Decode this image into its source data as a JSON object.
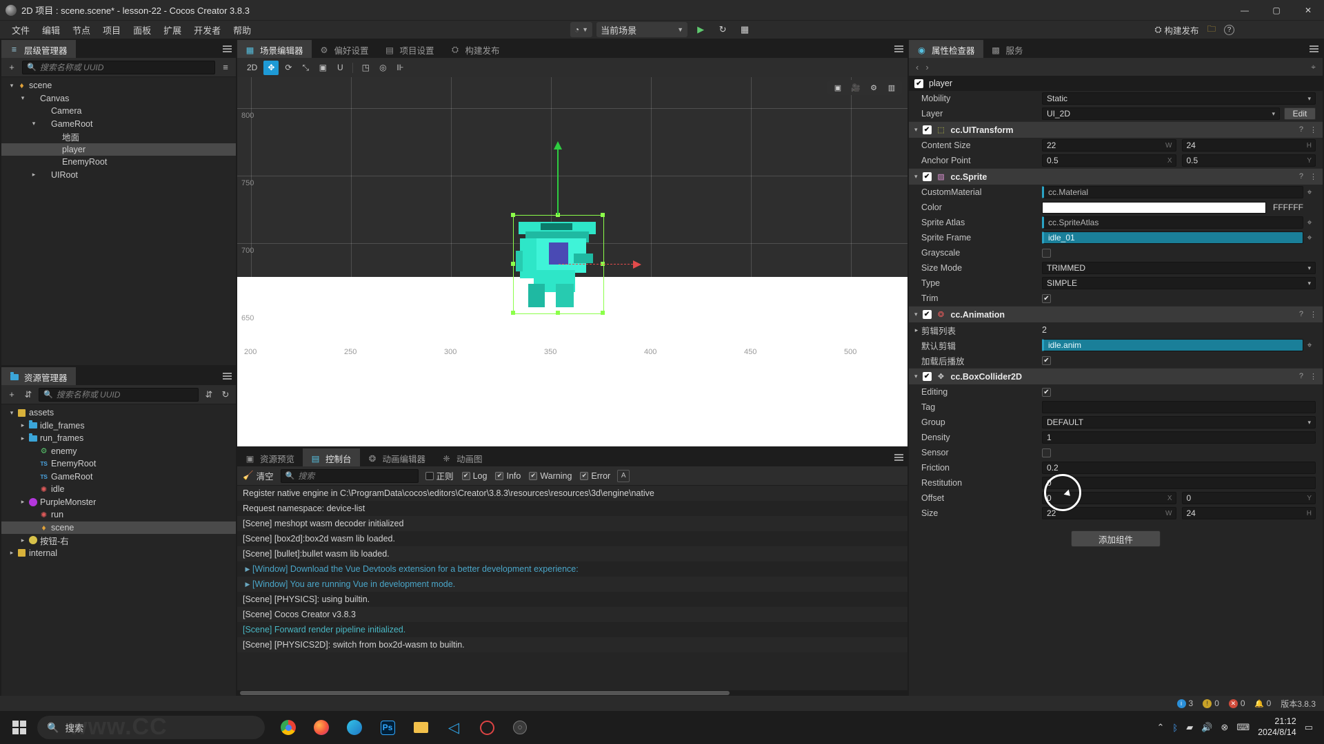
{
  "titlebar": {
    "title": "2D 项目 : scene.scene* - lesson-22 - Cocos Creator 3.8.3",
    "minimize": "—",
    "maximize": "▢",
    "close": "✕"
  },
  "menubar": {
    "items": [
      "文件",
      "编辑",
      "节点",
      "项目",
      "面板",
      "扩展",
      "开发者",
      "帮助"
    ],
    "scene_select": "当前场景",
    "play_icon": "▶",
    "refresh_icon": "↻",
    "device_icon": "▦",
    "build_label": "构建发布",
    "folder_icon": "📁",
    "help_icon": "?"
  },
  "hierarchy": {
    "tab_label": "层级管理器",
    "search_placeholder": "搜索名称或 UUID",
    "add_icon": "+",
    "filter_icon": "≡",
    "nodes": [
      {
        "label": "scene",
        "depth": 0,
        "icon": "scene-icon",
        "twisty": "▾",
        "selected": false
      },
      {
        "label": "Canvas",
        "depth": 1,
        "icon": "none",
        "twisty": "▾",
        "selected": false
      },
      {
        "label": "Camera",
        "depth": 2,
        "icon": "none",
        "twisty": "",
        "selected": false
      },
      {
        "label": "GameRoot",
        "depth": 2,
        "icon": "none",
        "twisty": "▾",
        "selected": false
      },
      {
        "label": "地面",
        "depth": 3,
        "icon": "none",
        "twisty": "",
        "selected": false
      },
      {
        "label": "player",
        "depth": 3,
        "icon": "none",
        "twisty": "",
        "selected": true
      },
      {
        "label": "EnemyRoot",
        "depth": 3,
        "icon": "none",
        "twisty": "",
        "selected": false
      },
      {
        "label": "UIRoot",
        "depth": 2,
        "icon": "none",
        "twisty": "▸",
        "selected": false
      }
    ]
  },
  "assets": {
    "tab_label": "资源管理器",
    "search_placeholder": "搜索名称或 UUID",
    "add_icon": "+",
    "sort_icon": "⇵",
    "refresh_icon": "↻",
    "nodes": [
      {
        "label": "assets",
        "depth": 0,
        "icon": "assets-icon",
        "twisty": "▾",
        "selected": false
      },
      {
        "label": "idle_frames",
        "depth": 1,
        "icon": "folder-icon",
        "twisty": "▸",
        "selected": false
      },
      {
        "label": "run_frames",
        "depth": 1,
        "icon": "folder-icon",
        "twisty": "▸",
        "selected": false
      },
      {
        "label": "enemy",
        "depth": 2,
        "icon": "prefab-icon",
        "twisty": "",
        "selected": false
      },
      {
        "label": "EnemyRoot",
        "depth": 2,
        "icon": "ts-icon",
        "twisty": "",
        "selected": false
      },
      {
        "label": "GameRoot",
        "depth": 2,
        "icon": "ts-icon",
        "twisty": "",
        "selected": false
      },
      {
        "label": "idle",
        "depth": 2,
        "icon": "anim-icon",
        "twisty": "",
        "selected": false
      },
      {
        "label": "PurpleMonster",
        "depth": 1,
        "icon": "monster-icon",
        "twisty": "▸",
        "selected": false
      },
      {
        "label": "run",
        "depth": 2,
        "icon": "anim-icon",
        "twisty": "",
        "selected": false
      },
      {
        "label": "scene",
        "depth": 2,
        "icon": "scene-icon",
        "twisty": "",
        "selected": true
      },
      {
        "label": "按钮-右",
        "depth": 1,
        "icon": "button-icon",
        "twisty": "▸",
        "selected": false
      },
      {
        "label": "internal",
        "depth": 0,
        "icon": "assets-icon",
        "twisty": "▸",
        "selected": false
      }
    ]
  },
  "sceneview": {
    "tabs": [
      {
        "label": "场景编辑器",
        "icon": "scene-editor-icon",
        "active": true
      },
      {
        "label": "偏好设置",
        "icon": "gear-icon",
        "active": false
      },
      {
        "label": "项目设置",
        "icon": "project-icon",
        "active": false
      },
      {
        "label": "构建发布",
        "icon": "build-icon",
        "active": false
      }
    ],
    "mode_label": "2D",
    "tools": [
      "move-tool",
      "rotate-tool",
      "scale-tool",
      "rect-tool",
      "unit-tool",
      "align-tool",
      "pivot-tool",
      "ruler-tool"
    ],
    "overlay_buttons": [
      "camera-preview-icon",
      "camera-icon",
      "gizmo-settings-icon",
      "effects-icon"
    ],
    "ruler_y": [
      "800",
      "750",
      "700",
      "650"
    ],
    "ruler_x": [
      "200",
      "250",
      "300",
      "350",
      "400",
      "450",
      "500"
    ]
  },
  "console": {
    "tabs": [
      {
        "label": "资源预览",
        "icon": "assets-preview-icon",
        "active": false
      },
      {
        "label": "控制台",
        "icon": "console-icon",
        "active": true
      },
      {
        "label": "动画编辑器",
        "icon": "anim-editor-icon",
        "active": false
      },
      {
        "label": "动画图",
        "icon": "anim-graph-icon",
        "active": false
      }
    ],
    "clear_label": "清空",
    "search_placeholder": "搜索",
    "filters": [
      {
        "label": "正则",
        "checked": false
      },
      {
        "label": "Log",
        "checked": true
      },
      {
        "label": "Info",
        "checked": true
      },
      {
        "label": "Warning",
        "checked": true
      },
      {
        "label": "Error",
        "checked": true
      }
    ],
    "font_icon": "A",
    "logs": [
      {
        "text": "Register native engine in C:\\ProgramData\\cocos\\editors\\Creator\\3.8.3\\resources\\resources\\3d\\engine\\native",
        "style": "info",
        "expandable": false
      },
      {
        "text": "Request namespace: device-list",
        "style": "info",
        "expandable": false
      },
      {
        "text": "[Scene] meshopt wasm decoder initialized",
        "style": "info",
        "expandable": false
      },
      {
        "text": "[Scene] [box2d]:box2d wasm lib loaded.",
        "style": "info",
        "expandable": false
      },
      {
        "text": "[Scene] [bullet]:bullet wasm lib loaded.",
        "style": "info",
        "expandable": false
      },
      {
        "text": "[Window] Download the Vue Devtools extension for a better development experience:",
        "style": "vue",
        "expandable": true
      },
      {
        "text": "[Window] You are running Vue in development mode.",
        "style": "vue",
        "expandable": true
      },
      {
        "text": "[Scene] [PHYSICS]: using builtin.",
        "style": "info",
        "expandable": false
      },
      {
        "text": "[Scene] Cocos Creator v3.8.3",
        "style": "info",
        "expandable": false
      },
      {
        "text": "[Scene] Forward render pipeline initialized.",
        "style": "ok",
        "expandable": false
      },
      {
        "text": "[Scene] [PHYSICS2D]: switch from box2d-wasm to builtin.",
        "style": "info",
        "expandable": false
      }
    ]
  },
  "inspector": {
    "tabs": [
      {
        "label": "属性检查器",
        "icon": "inspector-icon",
        "active": true
      },
      {
        "label": "服务",
        "icon": "services-icon",
        "active": false
      }
    ],
    "back_icon": "‹",
    "forward_icon": "›",
    "pin_icon": "⌖",
    "node_name": "player",
    "node_props": [
      {
        "label": "Mobility",
        "value": "Static",
        "type": "select"
      },
      {
        "label": "Layer",
        "value": "UI_2D",
        "type": "select-edit",
        "edit_label": "Edit"
      }
    ],
    "components": [
      {
        "name": "cc.UITransform",
        "icon": "uitransform-icon",
        "enabled": true,
        "rows": [
          {
            "label": "Content Size",
            "type": "vec2",
            "x": "22",
            "y": "24",
            "sx": "W",
            "sy": "H"
          },
          {
            "label": "Anchor Point",
            "type": "vec2",
            "x": "0.5",
            "y": "0.5",
            "sx": "X",
            "sy": "Y"
          }
        ]
      },
      {
        "name": "cc.Sprite",
        "icon": "sprite-icon",
        "enabled": true,
        "rows": [
          {
            "label": "CustomMaterial",
            "type": "asset",
            "value": "cc.Material"
          },
          {
            "label": "Color",
            "type": "color",
            "value": "FFFFFF",
            "swatch": "#ffffff"
          },
          {
            "label": "Sprite Atlas",
            "type": "asset",
            "value": "cc.SpriteAtlas"
          },
          {
            "label": "Sprite Frame",
            "type": "assetfill",
            "value": "idle_01"
          },
          {
            "label": "Grayscale",
            "type": "checkbox",
            "checked": false
          },
          {
            "label": "Size Mode",
            "type": "select",
            "value": "TRIMMED"
          },
          {
            "label": "Type",
            "type": "select",
            "value": "SIMPLE"
          },
          {
            "label": "Trim",
            "type": "checkbox",
            "checked": true
          }
        ]
      },
      {
        "name": "cc.Animation",
        "icon": "animation-icon",
        "enabled": true,
        "rows": [
          {
            "label": "剪辑列表",
            "type": "number-fold",
            "value": "2",
            "twisty": "▸"
          },
          {
            "label": "默认剪辑",
            "type": "assetfill",
            "value": "idle.anim"
          },
          {
            "label": "加载后播放",
            "type": "checkbox",
            "checked": true
          }
        ]
      },
      {
        "name": "cc.BoxCollider2D",
        "icon": "collider-icon",
        "enabled": true,
        "rows": [
          {
            "label": "Editing",
            "type": "checkbox",
            "checked": true
          },
          {
            "label": "Tag",
            "type": "text",
            "value": ""
          },
          {
            "label": "Group",
            "type": "select",
            "value": "DEFAULT"
          },
          {
            "label": "Density",
            "type": "text",
            "value": "1"
          },
          {
            "label": "Sensor",
            "type": "checkbox",
            "checked": false
          },
          {
            "label": "Friction",
            "type": "text",
            "value": "0.2"
          },
          {
            "label": "Restitution",
            "type": "text",
            "value": "0"
          },
          {
            "label": "Offset",
            "type": "vec2",
            "x": "0",
            "y": "0",
            "sx": "X",
            "sy": "Y"
          },
          {
            "label": "Size",
            "type": "vec2",
            "x": "22",
            "y": "24",
            "sx": "W",
            "sy": "H"
          }
        ]
      }
    ],
    "add_component_label": "添加组件"
  },
  "statusbar": {
    "info_count": "3",
    "warning_count": "0",
    "error_count": "0",
    "notification_count": "0",
    "version": "版本3.8.3"
  },
  "taskbar": {
    "search_placeholder": "搜索",
    "search_icon": "search-icon",
    "apps": [
      "chrome-icon",
      "firefox-icon",
      "edge-icon",
      "photoshop-icon",
      "explorer-icon",
      "vscode-icon",
      "obs-icon",
      "cocos-icon"
    ],
    "time": "21:12",
    "date": "2024/8/14",
    "tray": [
      "chevron-up-icon",
      "bluetooth-icon",
      "network-icon",
      "volume-icon",
      "mute-icon",
      "input-icon"
    ],
    "watermark": "www.CC"
  }
}
